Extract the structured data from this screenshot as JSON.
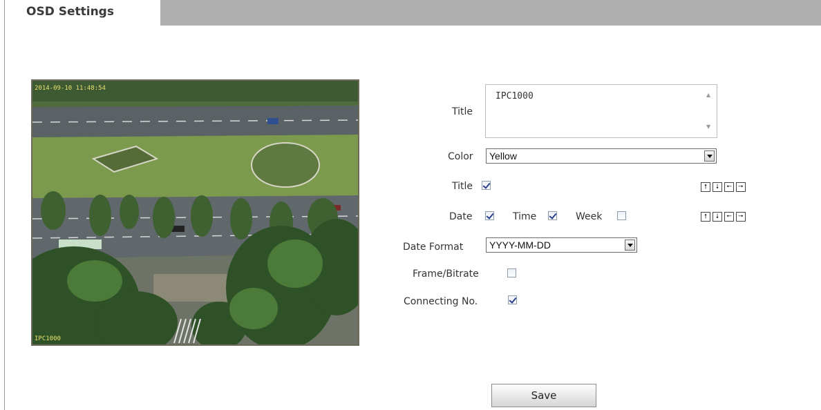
{
  "header": {
    "tab_title": "OSD Settings"
  },
  "preview": {
    "overlay_datetime": "2014-09-10 11:48:54",
    "overlay_title": "IPC1000"
  },
  "form": {
    "title_label": "Title",
    "title_value": "IPC1000",
    "color_label": "Color",
    "color_value": "Yellow",
    "title_show_label": "Title",
    "title_show_checked": true,
    "date_label": "Date",
    "date_checked": true,
    "time_label": "Time",
    "time_checked": true,
    "week_label": "Week",
    "week_checked": false,
    "date_format_label": "Date Format",
    "date_format_value": "YYYY-MM-DD",
    "frame_bitrate_label": "Frame/Bitrate",
    "frame_bitrate_checked": false,
    "connecting_no_label": "Connecting No.",
    "connecting_no_checked": true
  },
  "position_arrows": {
    "up": "🠕",
    "down": "🠗",
    "left": "🠔",
    "right": "🠖"
  },
  "actions": {
    "save_label": "Save"
  }
}
